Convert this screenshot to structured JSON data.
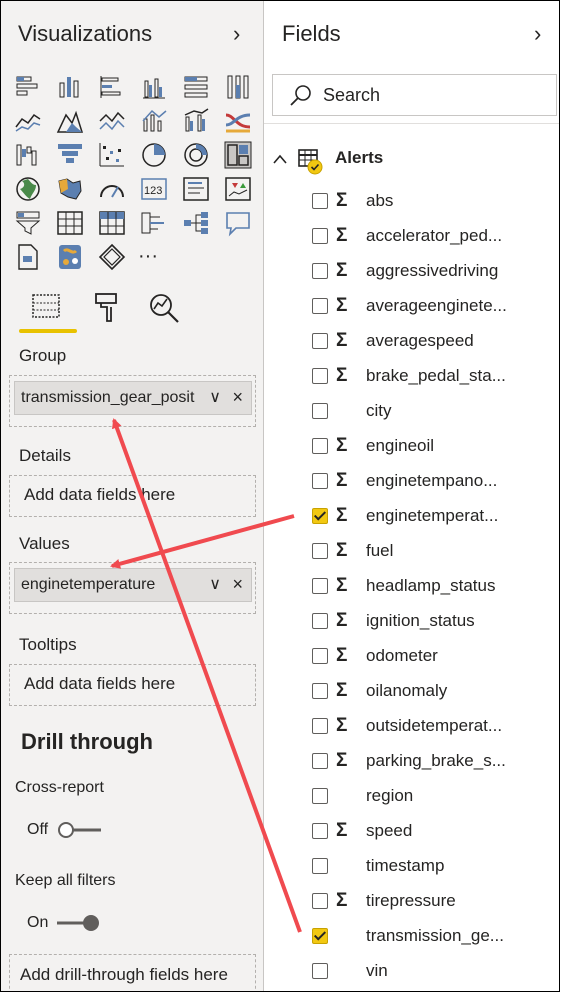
{
  "visualizations": {
    "title": "Visualizations",
    "collapse_glyph": "›",
    "icons": [
      "stacked-bar-icon",
      "stacked-column-icon",
      "clustered-bar-icon",
      "clustered-column-icon",
      "100-stacked-bar-icon",
      "100-stacked-column-icon",
      "line-chart-icon",
      "area-chart-icon",
      "stacked-area-icon",
      "line-column-icon",
      "line-clustered-column-icon",
      "ribbon-chart-icon",
      "waterfall-icon",
      "funnel-icon",
      "scatter-icon",
      "pie-icon",
      "donut-icon",
      "treemap-icon",
      "map-icon",
      "filled-map-icon",
      "gauge-icon",
      "card-icon",
      "multi-row-card-icon",
      "kpi-icon",
      "slicer-icon",
      "table-icon",
      "matrix-icon",
      "key-influencers-icon",
      "decomposition-tree-icon",
      "qna-icon",
      "paginated-report-icon",
      "python-visual-icon",
      "power-apps-icon",
      "more-visuals-icon"
    ],
    "more_glyph": "···",
    "tabs": [
      "fields-tab-icon",
      "format-tab-icon",
      "analytics-tab-icon"
    ],
    "group": {
      "label": "Group",
      "chip": "transmission_gear_posit",
      "chevron": "∨",
      "remove": "×"
    },
    "details": {
      "label": "Details",
      "placeholder": "Add data fields here"
    },
    "values": {
      "label": "Values",
      "chip": "enginetemperature",
      "chevron": "∨",
      "remove": "×"
    },
    "tooltips": {
      "label": "Tooltips",
      "placeholder": "Add data fields here"
    },
    "drill_through": {
      "title": "Drill through",
      "cross_report": {
        "label": "Cross-report",
        "state": "Off"
      },
      "keep_filters": {
        "label": "Keep all filters",
        "state": "On"
      },
      "placeholder": "Add drill-through fields here"
    }
  },
  "fields": {
    "title": "Fields",
    "collapse_glyph": "›",
    "search_placeholder": "Search",
    "table_name": "Alerts",
    "items": [
      {
        "name": "abs",
        "sigma": true,
        "checked": false
      },
      {
        "name": "accelerator_ped...",
        "sigma": true,
        "checked": false
      },
      {
        "name": "aggressivedriving",
        "sigma": true,
        "checked": false
      },
      {
        "name": "averageenginete...",
        "sigma": true,
        "checked": false
      },
      {
        "name": "averagespeed",
        "sigma": true,
        "checked": false
      },
      {
        "name": "brake_pedal_sta...",
        "sigma": true,
        "checked": false
      },
      {
        "name": "city",
        "sigma": false,
        "checked": false
      },
      {
        "name": "engineoil",
        "sigma": true,
        "checked": false
      },
      {
        "name": "enginetempano...",
        "sigma": true,
        "checked": false
      },
      {
        "name": "enginetemperat...",
        "sigma": true,
        "checked": true
      },
      {
        "name": "fuel",
        "sigma": true,
        "checked": false
      },
      {
        "name": "headlamp_status",
        "sigma": true,
        "checked": false
      },
      {
        "name": "ignition_status",
        "sigma": true,
        "checked": false
      },
      {
        "name": "odometer",
        "sigma": true,
        "checked": false
      },
      {
        "name": "oilanomaly",
        "sigma": true,
        "checked": false
      },
      {
        "name": "outsidetemperat...",
        "sigma": true,
        "checked": false
      },
      {
        "name": "parking_brake_s...",
        "sigma": true,
        "checked": false
      },
      {
        "name": "region",
        "sigma": false,
        "checked": false
      },
      {
        "name": "speed",
        "sigma": true,
        "checked": false
      },
      {
        "name": "timestamp",
        "sigma": false,
        "checked": false
      },
      {
        "name": "tirepressure",
        "sigma": true,
        "checked": false
      },
      {
        "name": "transmission_ge...",
        "sigma": false,
        "checked": true
      },
      {
        "name": "vin",
        "sigma": false,
        "checked": false
      }
    ],
    "sigma_glyph": "Σ"
  },
  "colors": {
    "accent": "#f2c811",
    "arrow": "#f04a4f",
    "pane_bg": "#f3f2f1",
    "chip_bg": "#e1dfdd"
  }
}
